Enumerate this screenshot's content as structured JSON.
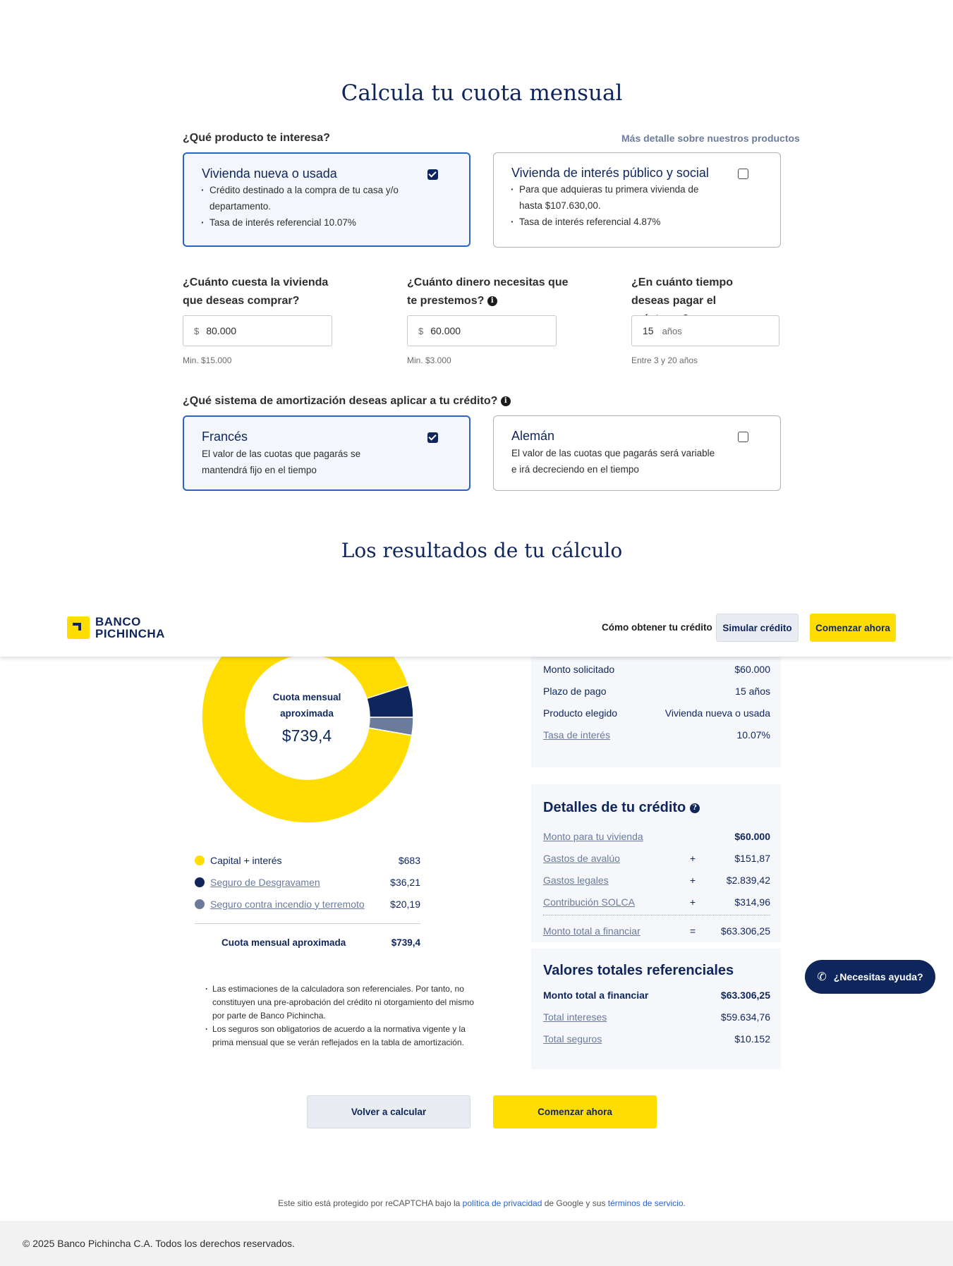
{
  "calc": {
    "title": "Calcula tu cuota mensual",
    "product_question": "¿Qué producto te interesa?",
    "product_link": "Más detalle sobre nuestros productos",
    "products": [
      {
        "title": "Vivienda nueva o usada",
        "bullets": [
          "Crédito destinado a la compra de tu casa y/o departamento.",
          "Tasa de interés referencial 10.07%"
        ],
        "selected": true
      },
      {
        "title": "Vivienda de interés público y social",
        "bullets": [
          "Para que adquieras tu primera vivienda de hasta $107.630,00.",
          "Tasa de interés referencial 4.87%"
        ],
        "selected": false
      }
    ],
    "fields": [
      {
        "label": "¿Cuánto cuesta la vivienda que deseas comprar?",
        "prefix": "$",
        "value": "80.000",
        "hint": "Min. $15.000"
      },
      {
        "label": "¿Cuánto dinero necesitas que te prestemos?",
        "prefix": "$",
        "value": "60.000",
        "hint": "Min. $3.000"
      },
      {
        "label": "¿En cuánto tiempo deseas pagar el préstamo?",
        "value": "15",
        "suffix": "años",
        "hint": "Entre 3 y 20 años"
      }
    ],
    "amort_question": "¿Qué sistema de amortización deseas aplicar a tu crédito?",
    "amort": [
      {
        "title": "Francés",
        "desc": "El valor de las cuotas que pagarás se mantendrá fijo en el tiempo",
        "selected": true
      },
      {
        "title": "Alemán",
        "desc": "El valor de las cuotas que pagarás será variable e irá decreciendo en el tiempo",
        "selected": false
      }
    ]
  },
  "results": {
    "title": "Los resultados de tu cálculo",
    "donut": {
      "center_label": "Cuota mensual aproximada",
      "center_value": "$739,4",
      "colors": [
        "#ffdd00",
        "#0f265c",
        "#6b7b9c"
      ],
      "values": [
        683,
        36.21,
        20.19
      ]
    },
    "legend": [
      {
        "label": "Capital + interés",
        "value": "$683",
        "color": "#ffdd00",
        "link": false
      },
      {
        "label": "Seguro de Desgravamen",
        "value": "$36,21",
        "color": "#0f265c",
        "link": true
      },
      {
        "label": "Seguro contra incendio y terremoto",
        "value": "$20,19",
        "color": "#6b7b9c",
        "link": true
      }
    ],
    "total_label": "Cuota mensual aproximada",
    "total_value": "$739,4",
    "notes": [
      "Las estimaciones de la calculadora son referenciales. Por tanto, no constituyen una pre-aprobación del crédito ni otorgamiento del mismo por parte de Banco Pichincha.",
      "Los seguros son obligatorios de acuerdo a la normativa vigente y la prima mensual que se verán reflejados en la tabla de amortización."
    ],
    "summary": [
      {
        "label": "Monto solicitado",
        "value": "$60.000",
        "link": false
      },
      {
        "label": "Plazo de pago",
        "value": "15 años",
        "link": false
      },
      {
        "label": "Producto elegido",
        "value": "Vivienda nueva o usada",
        "link": false
      },
      {
        "label": "Tasa de interés",
        "value": "10.07%",
        "link": true
      }
    ],
    "details": {
      "title": "Detalles de tu crédito",
      "rows": [
        {
          "label": "Monto para tu vivienda",
          "sign": "",
          "value": "$60.000"
        },
        {
          "label": "Gastos de avalúo",
          "sign": "+",
          "value": "$151,87"
        },
        {
          "label": "Gastos legales",
          "sign": "+",
          "value": "$2.839,42"
        },
        {
          "label": "Contribución SOLCA",
          "sign": "+",
          "value": "$314,96"
        }
      ],
      "total": {
        "label": "Monto total a financiar",
        "sign": "=",
        "value": "$63.306,25"
      }
    },
    "totals": {
      "title": "Valores totales referenciales",
      "rows": [
        {
          "label": "Monto total a financiar",
          "value": "$63.306,25",
          "link": false
        },
        {
          "label": "Total intereses",
          "value": "$59.634,76",
          "link": true
        },
        {
          "label": "Total seguros",
          "value": "$10.152",
          "link": true
        }
      ]
    },
    "buttons": {
      "recalc": "Volver a calcular",
      "start": "Comenzar ahora"
    }
  },
  "header": {
    "logo_line1": "BANCO",
    "logo_line2": "PICHINCHA",
    "nav_link": "Cómo obtener tu crédito",
    "simulate": "Simular crédito",
    "start": "Comenzar ahora"
  },
  "help": {
    "label": "¿Necesitas ayuda?"
  },
  "recaptcha": {
    "pre": "Este sitio está protegido por reCAPTCHA bajo la",
    "privacy": "política de privacidad",
    "mid": "de Google y sus",
    "terms": "términos de servicio",
    "end": "."
  },
  "footer": {
    "text": "© 2025 Banco Pichincha C.A. Todos los derechos reservados."
  }
}
